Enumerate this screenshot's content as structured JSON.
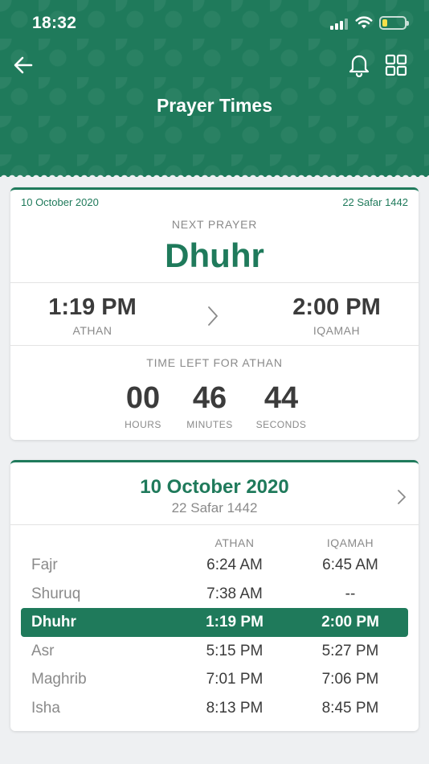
{
  "status_bar": {
    "time": "18:32"
  },
  "header": {
    "title": "Prayer Times"
  },
  "next_prayer": {
    "gregorian_date": "10 October 2020",
    "hijri_date": "22 Safar 1442",
    "label": "NEXT PRAYER",
    "name": "Dhuhr",
    "athan_time": "1:19 PM",
    "athan_label": "ATHAN",
    "iqamah_time": "2:00 PM",
    "iqamah_label": "IQAMAH",
    "countdown_label": "TIME LEFT FOR ATHAN",
    "hours": "00",
    "hours_label": "HOURS",
    "minutes": "46",
    "minutes_label": "MINUTES",
    "seconds": "44",
    "seconds_label": "SECONDS"
  },
  "schedule": {
    "date": "10 October 2020",
    "hijri": "22 Safar 1442",
    "col_athan": "ATHAN",
    "col_iqamah": "IQAMAH",
    "rows": [
      {
        "name": "Fajr",
        "athan": "6:24 AM",
        "iqamah": "6:45 AM"
      },
      {
        "name": "Shuruq",
        "athan": "7:38 AM",
        "iqamah": "--"
      },
      {
        "name": "Dhuhr",
        "athan": "1:19 PM",
        "iqamah": "2:00 PM"
      },
      {
        "name": "Asr",
        "athan": "5:15 PM",
        "iqamah": "5:27 PM"
      },
      {
        "name": "Maghrib",
        "athan": "7:01 PM",
        "iqamah": "7:06 PM"
      },
      {
        "name": "Isha",
        "athan": "8:13 PM",
        "iqamah": "8:45 PM"
      }
    ]
  },
  "colors": {
    "primary": "#1f7a5b",
    "background": "#eef0f2",
    "battery": "#f5e04a"
  },
  "icons": {
    "back": "arrow-left-icon",
    "bell": "bell-icon",
    "grid": "grid-icon",
    "chevron": "chevron-right-icon"
  }
}
